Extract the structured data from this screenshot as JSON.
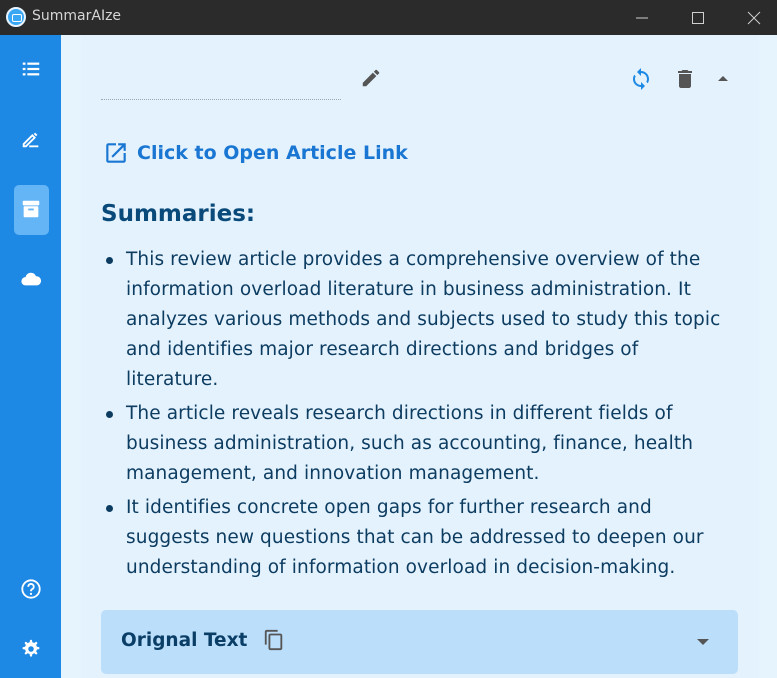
{
  "window": {
    "title": "SummarAIze"
  },
  "sidebar": {
    "items": [
      {
        "name": "list-icon",
        "active": false
      },
      {
        "name": "edit-icon",
        "active": false
      },
      {
        "name": "archive-icon",
        "active": true
      },
      {
        "name": "cloud-icon",
        "active": false
      },
      {
        "name": "moon-icon",
        "active": false
      },
      {
        "name": "help-icon",
        "active": false
      },
      {
        "name": "settings-icon",
        "active": false
      }
    ]
  },
  "summary_card": {
    "title_value": "",
    "article_link_label": "Click to Open Article Link",
    "summaries_heading": "Summaries:",
    "summaries": [
      "This review article provides a comprehensive overview of the information overload literature in business administration. It analyzes various methods and subjects used to study this topic and identifies major research directions and bridges of literature.",
      "The article reveals research directions in different fields of business administration, such as accounting, finance, health management, and innovation management.",
      "It identifies concrete open gaps for further research and suggests new questions that can be addressed to deepen our understanding of information overload in decision-making."
    ],
    "original_text_label": "Orignal Text"
  },
  "colors": {
    "sidebar": "#1e88e5",
    "sidebar_active": "#64b5f6",
    "background": "#e3f2fd",
    "link": "#1976d2",
    "heading": "#0a4a7a",
    "panel": "#bbdefb"
  }
}
